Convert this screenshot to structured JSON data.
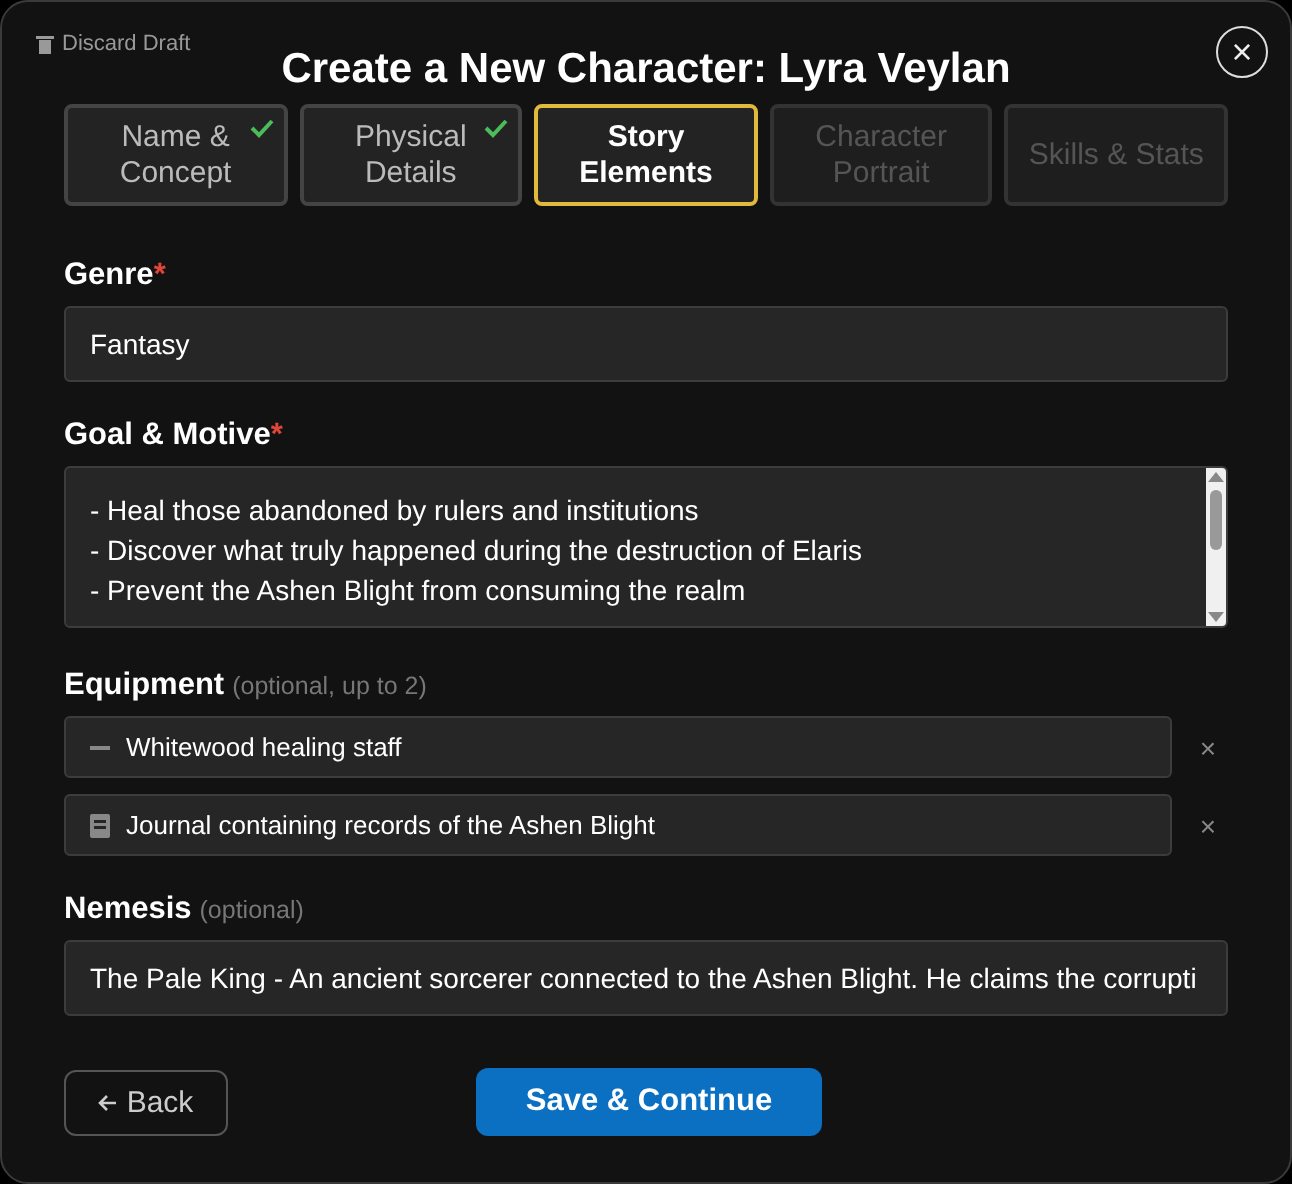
{
  "discard": "Discard Draft",
  "title": "Create a New Character: Lyra Veylan",
  "close": "×",
  "tabs": [
    {
      "label": "Name & Concept",
      "completed": true,
      "selected": false,
      "disabled": false
    },
    {
      "label": "Physical Details",
      "completed": true,
      "selected": false,
      "disabled": false
    },
    {
      "label": "Story Elements",
      "completed": false,
      "selected": true,
      "disabled": false
    },
    {
      "label": "Character Portrait",
      "completed": false,
      "selected": false,
      "disabled": true
    },
    {
      "label": "Skills & Stats",
      "completed": false,
      "selected": false,
      "disabled": true
    }
  ],
  "genre": {
    "label": "Genre",
    "required_mark": "*",
    "value": "Fantasy"
  },
  "goal": {
    "label": "Goal & Motive",
    "required_mark": "*",
    "lines": [
      "- Heal those abandoned by rulers and institutions",
      "- Discover what truly happened during the destruction of Elaris",
      "- Prevent the Ashen Blight from consuming the realm"
    ]
  },
  "equipment": {
    "label": "Equipment",
    "hint": "(optional, up to 2)",
    "items": [
      {
        "kind": "staff",
        "text": "Whitewood healing staff",
        "remove": "×"
      },
      {
        "kind": "book",
        "text": "Journal containing records of the Ashen Blight",
        "remove": "×"
      }
    ]
  },
  "nemesis": {
    "label": "Nemesis",
    "hint": "(optional)",
    "value": "The Pale King - An ancient sorcerer connected to the Ashen Blight. He claims the corrupti"
  },
  "back": "Back",
  "save": "Save & Continue"
}
